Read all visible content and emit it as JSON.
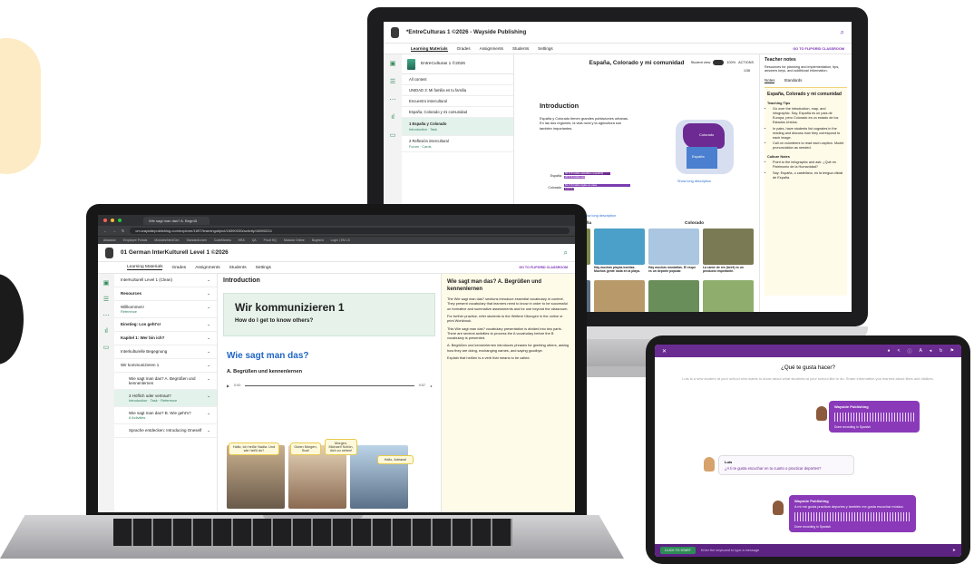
{
  "monitor": {
    "app_title": "*EntreCulturas 1 ©2026 - Wayside Publishing",
    "tabs": [
      "Learning Materials",
      "Grades",
      "Assignments",
      "Students",
      "Settings"
    ],
    "classroom_link": "GO TO FLIPGRID CLASSROOM",
    "book_title": "EntreCulturas 1 ©2026",
    "sidebar": [
      {
        "label": "All content"
      },
      {
        "label": "UNIDAD 3: Mi familia es tu familia"
      },
      {
        "label": "Encuentro intercultural"
      },
      {
        "label": "España, Colorado y mi comunidad"
      },
      {
        "label": "1 España y Colorado",
        "sub": "Introduction · Task",
        "selected": true
      },
      {
        "label": "2 Reflexión intercultural",
        "sub": "Forum · Cards"
      }
    ],
    "page_heading": "España, Colorado y mi comunidad",
    "student_view": "Student view",
    "zoom": "100%",
    "actions": "ACTIONS",
    "page_count": "1/38",
    "intro_heading": "Introduction",
    "intro_text": "España y Colorado tienen grandes poblaciones urbanas. En las dos regiones, la vida rural y la agricultura son también importantes.",
    "map_labels": {
      "spain": "Colorado",
      "colorado": "España"
    },
    "bars": [
      {
        "region": "España",
        "items": [
          {
            "text": "56.8 % habla castellano (español)",
            "value": 56.8,
            "color": "#6d2a92"
          },
          {
            "text": "25.5 % habla castellano y otras lenguas oficiales",
            "value": 25.5,
            "color": "#9a58c4"
          }
        ]
      },
      {
        "region": "Colorado",
        "items": [
          {
            "text": "81.3 % habla inglés en casa",
            "value": 81.3,
            "color": "#7b3db0"
          },
          {
            "text": "11.9 % habla español en casa",
            "value": 11.9,
            "color": "#6d2a92"
          }
        ]
      }
    ],
    "show_long_description": "Show long description",
    "columns": [
      "España",
      "Colorado"
    ],
    "photos": [
      {
        "caption": "Las olivas son un producto importante.",
        "color": "#7a8a4a"
      },
      {
        "caption": "Hay muchas playas bonitas. Muchos gente nada en la playa.",
        "color": "#4aa0c8"
      },
      {
        "caption": "Hay muchas montañas. El esquí es un deporte popular.",
        "color": "#aac6e0"
      },
      {
        "caption": "La carne de res (beef) es un producto importante.",
        "color": "#7a7a55"
      },
      {
        "caption": "El producto más exportado es el",
        "color": "#5a6c80"
      },
      {
        "caption": "Hay 10 lugares Patrimonio de la",
        "color": "#b89a6a"
      },
      {
        "caption": "Cuando no hay nieve, la gente va en",
        "color": "#6a8e5a"
      },
      {
        "caption": "Es conocido por las montañas, como también",
        "color": "#8fae6e"
      }
    ],
    "teacher_notes": {
      "title": "Teacher notes",
      "desc": "Resources for planning and implementation, tips, answers keys, and additional information.",
      "tabs": [
        "Notes",
        "Standards"
      ],
      "panel_title": "España, Colorado y mi comunidad",
      "section1": "Teaching Tips",
      "tips": [
        "Go over the introduction, map, and infographic. Say, España es un país de Europa, pero Colorado es un estado de los Estados Unidos.",
        "In pairs, have students list cognates in the reading and discuss how they correspond to each image.",
        "Call on volunteers to read each caption. Model pronunciation as needed."
      ],
      "section2": "Culture Notes",
      "culture": [
        "Point to the infographic and ask: ¿Qué es Patrimonio de la Humanidad?",
        "Say: España, o castellano, es la lengua oficial de España."
      ]
    }
  },
  "laptop": {
    "browser_tab": "Wie sagt man das? A. Begrüß",
    "url": "cm.waysidepublishing.com/explorer/1697/learningobject/16590030/activity/16590224",
    "bookmarks": [
      "Atlassian",
      "Employee Portals",
      "Modules/NextGen",
      "StandardLearn",
      "CodeMantra",
      "HRA",
      "QA",
      "Proof HQ",
      "Modular Online",
      "Bugherd",
      "Login | EM LS"
    ],
    "app_title": "01 German InterKulturell Level 1 ©2026",
    "tabs": [
      "Learning Materials",
      "Grades",
      "Assignments",
      "Students",
      "Settings"
    ],
    "classroom_link": "GO TO FLIPGRID CLASSROOM",
    "sidebar": [
      {
        "label": "InterKulturell Level 1 (Clean)"
      },
      {
        "label": "Resources",
        "bold": true
      },
      {
        "label": "Willkommen!",
        "sub": "Reference"
      },
      {
        "label": "Einstieg: Los geht's!",
        "bold": true
      },
      {
        "label": "Kapitel 1: Wer bin ich?",
        "bold": true
      },
      {
        "label": "Interkulturelle Begegnung"
      },
      {
        "label": "Wir kommunizieren 1"
      },
      {
        "label": "Wie sagt man das? A. Begrüßen und kennenlernen",
        "indent": true
      },
      {
        "label": "3 Höflich oder vertraut?",
        "sub": "Introduction · Task · Reference",
        "indent": true,
        "selected": true
      },
      {
        "label": "Wie sagt man das? B. Wie geht's?",
        "sub": "6 Activities",
        "indent": true
      },
      {
        "label": "Sprache entdecken: Introducing Oneself",
        "indent": true
      }
    ],
    "intro_heading": "Introduction",
    "hero_title": "Wir kommunizieren 1",
    "hero_subtitle": "How do I get to know others?",
    "section_title": "Wie sagt man das?",
    "subsection": "A. Begrüßen und kennenlernen",
    "audio_start": "0:00",
    "audio_end": "0:57",
    "bubbles": [
      "Hallo, ich heiße Nadia. Und wie heißt du?",
      "Guten Morgen, Susi!",
      "Morgen, Michael! Schön, dich zu sehen!",
      "Hallo, Adriana!"
    ],
    "notes_title": "Wie sagt man das? A. Begrüßen und kennenlernen",
    "notes_paragraphs": [
      "The Wie sagt man das? sections introduce essential vocabulary in context. They present vocabulary that learners need to know in order to be successful on formative and summative assessments and for use beyond the classroom.",
      "For further practice, refer students to the Weitere Übungen in the online or print Workbook.",
      "This Wie sagt man das? vocabulary presentation is divided into two parts. There are several activities to process the A vocabulary before the B vocabulary is presented.",
      "A. Begrüßen und kennenlernen introduces phrases for greeting others, asking how they are doing, exchanging names, and saying goodbye.",
      "Explain that heißen is a verb that means to be called."
    ]
  },
  "tablet": {
    "question": "¿Qué te gusta hacer?",
    "intro": "Luis is a new student at your school who wants to know about what students at your school like to do. Share information you learned about likes and dislikes.",
    "card1_name": "Wayside Publishing",
    "card1_label": "Done recording in Spanish",
    "luis_name": "Luis",
    "luis_msg": "¿A ti te gusta escuchar en tu cuarto o practicar deportes?",
    "card2_name": "Wayside Publishing",
    "card2_text": "A mí me gusta practicar deportes y también me gusta escuchar música.",
    "card2_label": "Done recording in Spanish",
    "start_btn": "CLICK TO START",
    "input_placeholder": "Enter the keyboard to type a message"
  }
}
